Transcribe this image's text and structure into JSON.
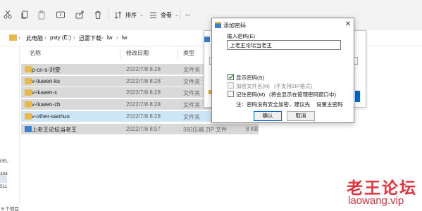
{
  "toolbar": {
    "sort_label": "排序",
    "view_label": "查看",
    "more_label": "···"
  },
  "breadcrumb": [
    "此电脑",
    "psty (E:)",
    "迅雷下载",
    "lw",
    "lw"
  ],
  "columns": {
    "name": "名称",
    "modified": "修改日期",
    "type": "类型"
  },
  "files": [
    {
      "name": "p-cn-s-刘雯",
      "date": "2022/7/8 8:28",
      "type": "文件夹",
      "size": "",
      "kind": "folder",
      "highlight": "gray"
    },
    {
      "name": "v-liuwen-ks",
      "date": "2022/7/8 8:28",
      "type": "文件夹",
      "size": "",
      "kind": "folder",
      "highlight": "gray"
    },
    {
      "name": "v-liuwen-x",
      "date": "2022/7/8 8:28",
      "type": "文件夹",
      "size": "",
      "kind": "folder",
      "highlight": "gray"
    },
    {
      "name": "v-liuwen-zb",
      "date": "2022/7/8 8:28",
      "type": "文件夹",
      "size": "",
      "kind": "folder",
      "highlight": "gray"
    },
    {
      "name": "v-other-saohuo",
      "date": "2022/7/8 8:28",
      "type": "文件夹",
      "size": "",
      "kind": "folder",
      "highlight": "blue"
    },
    {
      "name": "上老王论坛当老王",
      "date": "2022/7/8 8:57",
      "type": "360压缩 ZIP 文件",
      "size": "8 KB",
      "kind": "zip",
      "highlight": "gray"
    }
  ],
  "nav_fragments": [
    "0EL",
    "304",
    "511"
  ],
  "status": "6 个项目",
  "bg_dialog": {
    "fragment": "压"
  },
  "dialog": {
    "title": "添加密码",
    "close": "✕",
    "password_label": "输入密码(E)",
    "password_value": "上老王论坛当老王",
    "show_password_label": "显示密码(S)",
    "show_password_checked": true,
    "encrypt_names_label": "加密文件名(N)",
    "encrypt_names_note": "(不支持ZIP格式)",
    "encrypt_names_enabled": false,
    "remember_label": "记住密码(M)",
    "remember_note": "(将会显示在管理密码窗口中)",
    "note_prefix": "注：密码没有安全加密，建议先",
    "note_link": "设置主密码",
    "ok_label": "确认",
    "cancel_label": "取消"
  },
  "watermark": {
    "cn": "老王论坛",
    "en": "laowang.vip"
  },
  "colors": {
    "accent": "#0a64c8",
    "selection": "#cde6f7",
    "watermark": "#e3343d",
    "folder": "#e9b949"
  }
}
